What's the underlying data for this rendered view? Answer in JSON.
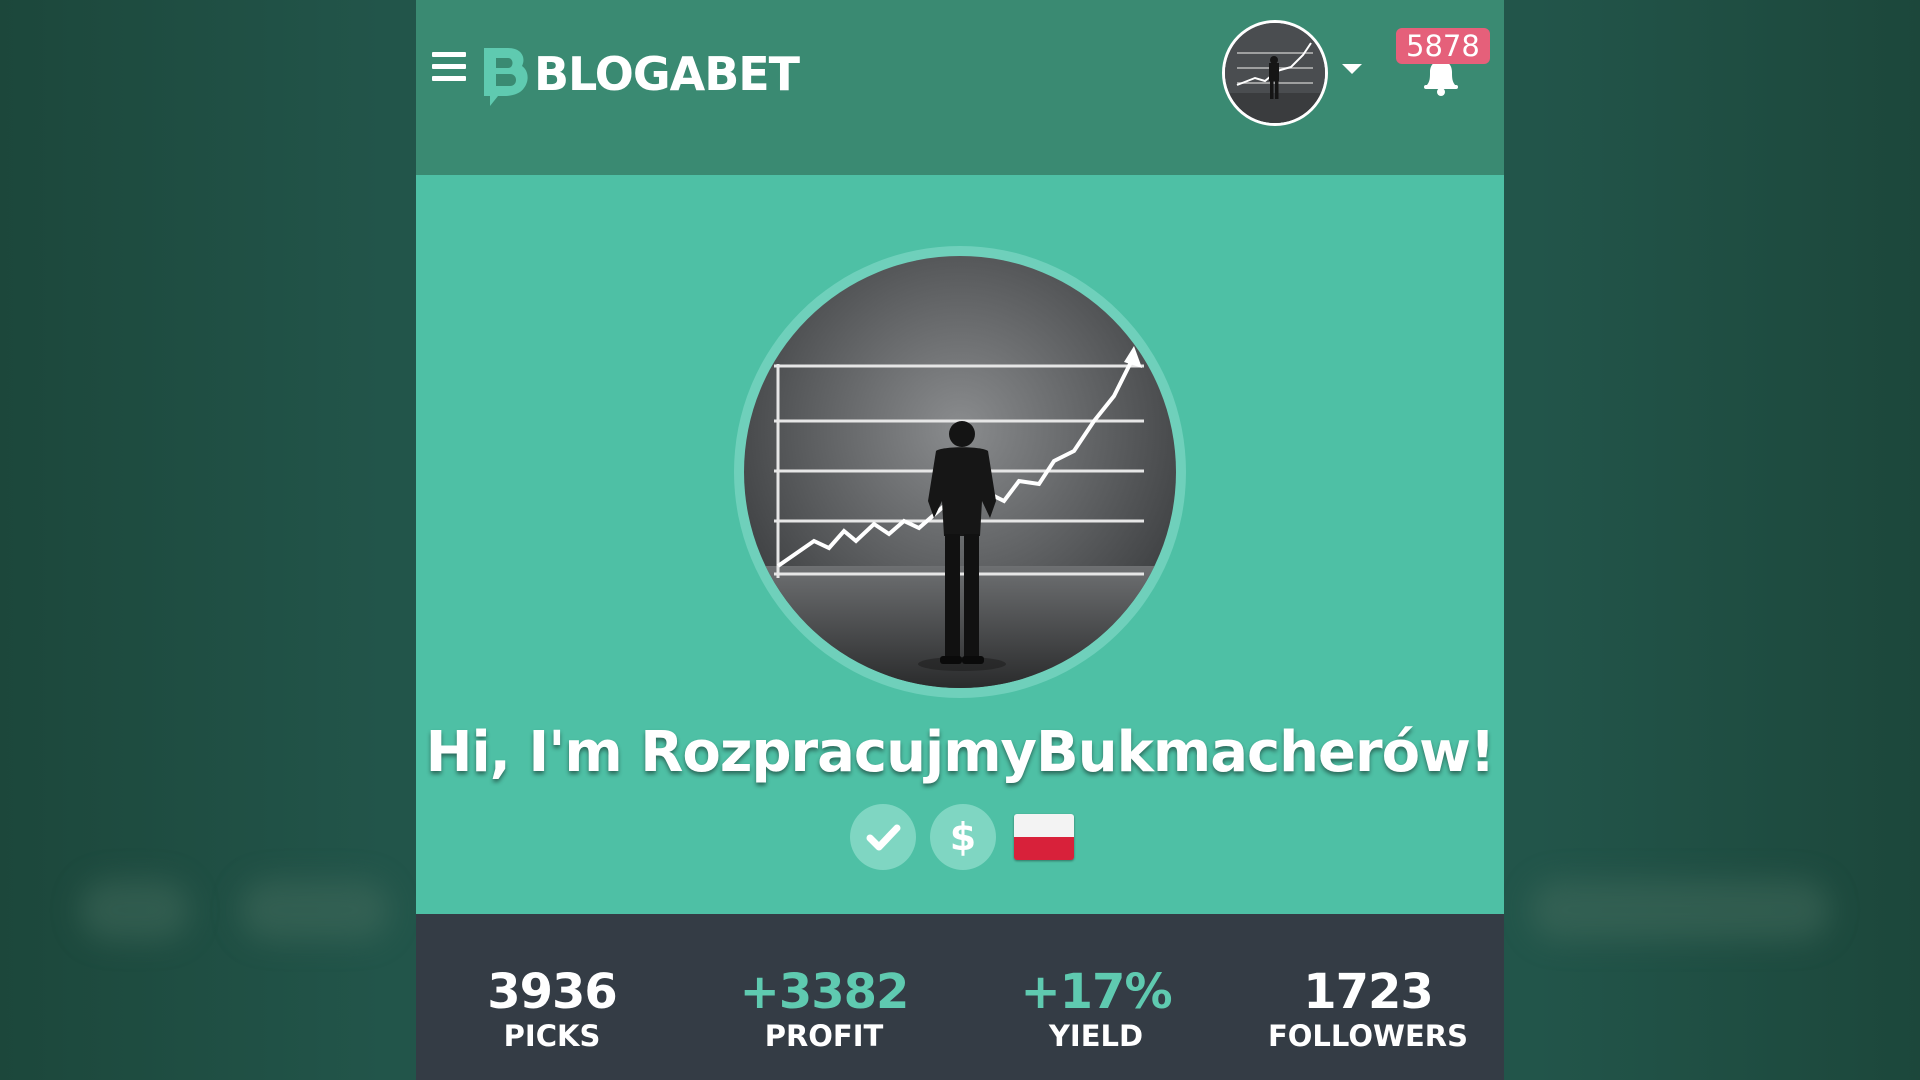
{
  "header": {
    "brand": "BLOGABET",
    "notifications_count": "5878"
  },
  "profile": {
    "greeting": "Hi, I'm RozpracujmyBukmacherów!",
    "badges": [
      "verified-check-icon",
      "paid-dollar-icon",
      "poland-flag-icon"
    ]
  },
  "stats": [
    {
      "value": "3936",
      "label": "PICKS"
    },
    {
      "value": "+3382",
      "label": "PROFIT"
    },
    {
      "value": "+17%",
      "label": "YIELD"
    },
    {
      "value": "1723",
      "label": "FOLLOWERS"
    }
  ],
  "colors": {
    "header": "#3a8a72",
    "hero": "#4ec0a5",
    "stats_bar": "#343c45",
    "badge": "#e5607a",
    "positive": "#5fcab0"
  }
}
